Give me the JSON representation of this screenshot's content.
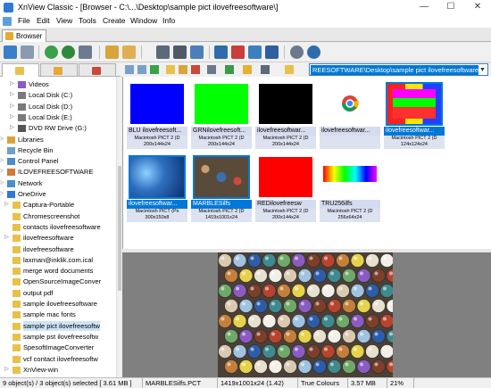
{
  "window": {
    "title": "XnView Classic - [Browser - C:\\...\\Desktop\\sample pict ilovefreesoftware\\]",
    "minimize": "—",
    "maximize": "☐",
    "close": "✕"
  },
  "menu": [
    "File",
    "Edit",
    "View",
    "Tools",
    "Create",
    "Window",
    "Info"
  ],
  "tab": {
    "label": "Browser"
  },
  "address": {
    "value": "REESOFTWARE\\Desktop\\sample pict ilovefreesoftware\\"
  },
  "tree": [
    {
      "label": "Videos",
      "exp": "▷",
      "icon": "folder-video-icon",
      "color": "#8a5cc2"
    },
    {
      "label": "Local Disk (C:)",
      "exp": "▷",
      "icon": "drive-icon",
      "color": "#7a7a7a"
    },
    {
      "label": "Local Disk (D:)",
      "exp": "▷",
      "icon": "drive-icon",
      "color": "#7a7a7a"
    },
    {
      "label": "Local Disk (E:)",
      "exp": "▷",
      "icon": "drive-icon",
      "color": "#7a7a7a"
    },
    {
      "label": "DVD RW Drive (G:)",
      "exp": "▷",
      "icon": "dvd-icon",
      "color": "#555555"
    },
    {
      "label": "Libraries",
      "exp": "▷",
      "icon": "libraries-icon",
      "color": "#d8a53a"
    },
    {
      "label": "Recycle Bin",
      "exp": "",
      "icon": "recycle-bin-icon",
      "color": "#6fa0c8"
    },
    {
      "label": "Control Panel",
      "exp": "▷",
      "icon": "control-panel-icon",
      "color": "#4c8dc9"
    },
    {
      "label": "ILOVEFREESOFTWARE",
      "exp": "▷",
      "icon": "user-icon",
      "color": "#d07a3a"
    },
    {
      "label": "Network",
      "exp": "▷",
      "icon": "network-icon",
      "color": "#4c8dc9"
    },
    {
      "label": "OneDrive",
      "exp": "▷",
      "icon": "onedrive-icon",
      "color": "#2e7bd6"
    },
    {
      "label": "Captura-Portable",
      "exp": "▷",
      "icon": "folder-icon",
      "color": "#e8c14a"
    },
    {
      "label": "Chromescreenshot",
      "exp": "",
      "icon": "folder-icon",
      "color": "#e8c14a"
    },
    {
      "label": "contacts ilovefreesoftware",
      "exp": "",
      "icon": "folder-icon",
      "color": "#e8c14a"
    },
    {
      "label": "ilovefreesoftware",
      "exp": "▷",
      "icon": "folder-icon",
      "color": "#e8c14a"
    },
    {
      "label": "ilovefreesoftware",
      "exp": "",
      "icon": "folder-icon",
      "color": "#e8c14a"
    },
    {
      "label": "laxman@inklik.com.ical",
      "exp": "",
      "icon": "folder-icon",
      "color": "#e8c14a"
    },
    {
      "label": "merge word documents",
      "exp": "",
      "icon": "folder-icon",
      "color": "#e8c14a"
    },
    {
      "label": "OpenSourceImageConver",
      "exp": "",
      "icon": "folder-icon",
      "color": "#e8c14a"
    },
    {
      "label": "output pdf",
      "exp": "",
      "icon": "folder-icon",
      "color": "#e8c14a"
    },
    {
      "label": "sample ilovefreesoftware",
      "exp": "",
      "icon": "folder-icon",
      "color": "#e8c14a"
    },
    {
      "label": "sample mac fonts",
      "exp": "",
      "icon": "folder-icon",
      "color": "#e8c14a"
    },
    {
      "label": "sample pict ilovefreesoftw",
      "exp": "",
      "icon": "folder-icon",
      "color": "#e8c14a",
      "selected": true
    },
    {
      "label": "sample pst ilovefreesoftw",
      "exp": "",
      "icon": "folder-icon",
      "color": "#e8c14a"
    },
    {
      "label": "SpesoftImageConverter",
      "exp": "",
      "icon": "folder-icon",
      "color": "#e8c14a"
    },
    {
      "label": "vcf contact ilovefreesoftw",
      "exp": "",
      "icon": "folder-icon",
      "color": "#e8c14a"
    },
    {
      "label": "XnView-win",
      "exp": "▷",
      "icon": "folder-icon",
      "color": "#e8c14a"
    }
  ],
  "thumbnails": [
    {
      "name": "BLU ilovefreesoft...",
      "format": "Macintosh PICT 2 (D",
      "size": "200x144x24",
      "kind": "solid",
      "color": "#0000ff"
    },
    {
      "name": "GRNilovefreesoft...",
      "format": "Macintosh PICT 2 (D",
      "size": "200x144x24",
      "kind": "solid",
      "color": "#00ff00"
    },
    {
      "name": "ilovefreesoftwar...",
      "format": "Macintosh PICT 2 (D",
      "size": "200x144x24",
      "kind": "solid",
      "color": "#000000"
    },
    {
      "name": "ilovefreesoftwar...",
      "format": "",
      "size": "",
      "kind": "chrome"
    },
    {
      "name": "ilovefreesoftwar...",
      "format": "Macintosh PICT 2 (D",
      "size": "124x124x24",
      "kind": "collage",
      "selected": true
    },
    {
      "name": "ilovefreesoftwar...",
      "format": "Macintosh PICT (Ps",
      "size": "300x150x8",
      "kind": "underwater",
      "selected": true
    },
    {
      "name": "MARBLESilfs",
      "format": "Macintosh PICT 2 (D",
      "size": "1419x1001x24",
      "kind": "marbles",
      "selected": true
    },
    {
      "name": "REDilovefreesw",
      "format": "Macintosh PICT 2 (D",
      "size": "200x144x24",
      "kind": "solid",
      "color": "#ff0000"
    },
    {
      "name": "TRU256ilfs",
      "format": "Macintosh PICT 2 (D",
      "size": "256x64x24",
      "kind": "palette"
    }
  ],
  "status": {
    "objects": "9 object(s) / 3 object(s) selected  [ 3.61 MB ]",
    "filename": "MARBLESilfs.PCT",
    "dimensions": "1419x1001x24 (1.42)",
    "colours": "True Colours",
    "filesize": "3.57 MB",
    "zoom": "21%"
  },
  "colors": {
    "selection": "#0078d7",
    "tree_selection": "#cce4f7",
    "thumb_caption": "#d6dcef",
    "preview_bg": "#808080"
  }
}
